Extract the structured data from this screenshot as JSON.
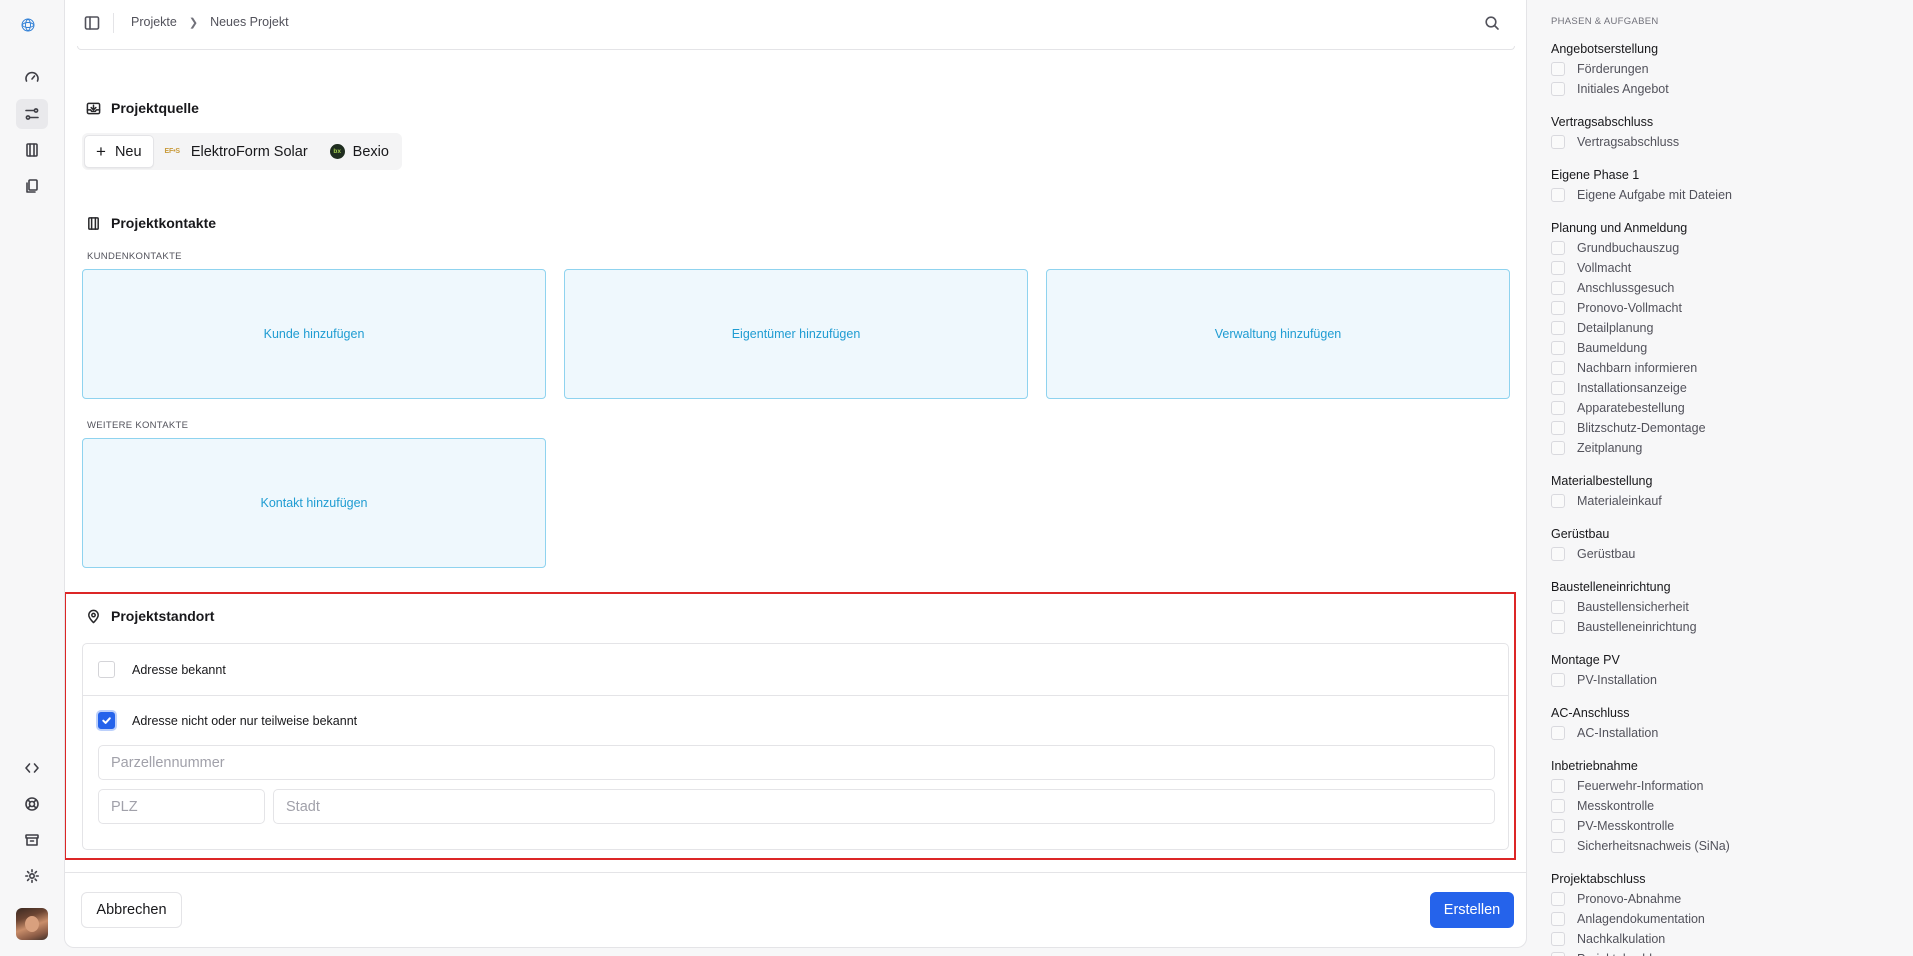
{
  "breadcrumb": {
    "items": [
      "Projekte",
      "Neues Projekt"
    ]
  },
  "projektquelle": {
    "title": "Projektquelle",
    "options": [
      {
        "label": "Neu",
        "icon": "plus-icon"
      },
      {
        "label": "ElektroForm Solar",
        "icon": "elektroform-logo",
        "logo_text": "EF•S"
      },
      {
        "label": "Bexio",
        "icon": "bexio-logo",
        "logo_text": "bx"
      }
    ]
  },
  "projektkontakte": {
    "title": "Projektkontakte",
    "kunden_caption": "KUNDENKONTAKTE",
    "kunde": "Kunde hinzufügen",
    "eigentuemer": "Eigentümer hinzufügen",
    "verwaltung": "Verwaltung hinzufügen",
    "weitere_caption": "WEITERE KONTAKTE",
    "kontakt": "Kontakt hinzufügen"
  },
  "projektstandort": {
    "title": "Projektstandort",
    "opt_known": "Adresse bekannt",
    "opt_unknown": "Adresse nicht oder nur teilweise bekannt",
    "opt_known_checked": false,
    "opt_unknown_checked": true,
    "parcel_placeholder": "Parzellennummer",
    "plz_placeholder": "PLZ",
    "city_placeholder": "Stadt"
  },
  "footer": {
    "cancel": "Abbrechen",
    "create": "Erstellen"
  },
  "colors": {
    "primary": "#2563eb",
    "highlight": "#dc2626",
    "card_border": "#8fd3ef",
    "card_text": "#1f9cd2"
  },
  "phases": {
    "title": "PHASEN & AUFGABEN",
    "groups": [
      {
        "name": "Angebotserstellung",
        "tasks": [
          "Förderungen",
          "Initiales Angebot"
        ]
      },
      {
        "name": "Vertragsabschluss",
        "tasks": [
          "Vertragsabschluss"
        ]
      },
      {
        "name": "Eigene Phase 1",
        "tasks": [
          "Eigene Aufgabe mit Dateien"
        ]
      },
      {
        "name": "Planung und Anmeldung",
        "tasks": [
          "Grundbuchauszug",
          "Vollmacht",
          "Anschlussgesuch",
          "Pronovo-Vollmacht",
          "Detailplanung",
          "Baumeldung",
          "Nachbarn informieren",
          "Installationsanzeige",
          "Apparatebestellung",
          "Blitzschutz-Demontage",
          "Zeitplanung"
        ]
      },
      {
        "name": "Materialbestellung",
        "tasks": [
          "Materialeinkauf"
        ]
      },
      {
        "name": "Gerüstbau",
        "tasks": [
          "Gerüstbau"
        ]
      },
      {
        "name": "Baustelleneinrichtung",
        "tasks": [
          "Baustellensicherheit",
          "Baustelleneinrichtung"
        ]
      },
      {
        "name": "Montage PV",
        "tasks": [
          "PV-Installation"
        ]
      },
      {
        "name": "AC-Anschluss",
        "tasks": [
          "AC-Installation"
        ]
      },
      {
        "name": "Inbetriebnahme",
        "tasks": [
          "Feuerwehr-Information",
          "Messkontrolle",
          "PV-Messkontrolle",
          "Sicherheitsnachweis (SiNa)"
        ]
      },
      {
        "name": "Projektabschluss",
        "tasks": [
          "Pronovo-Abnahme",
          "Anlagendokumentation",
          "Nachkalkulation",
          "Projektabschluss"
        ]
      }
    ]
  }
}
